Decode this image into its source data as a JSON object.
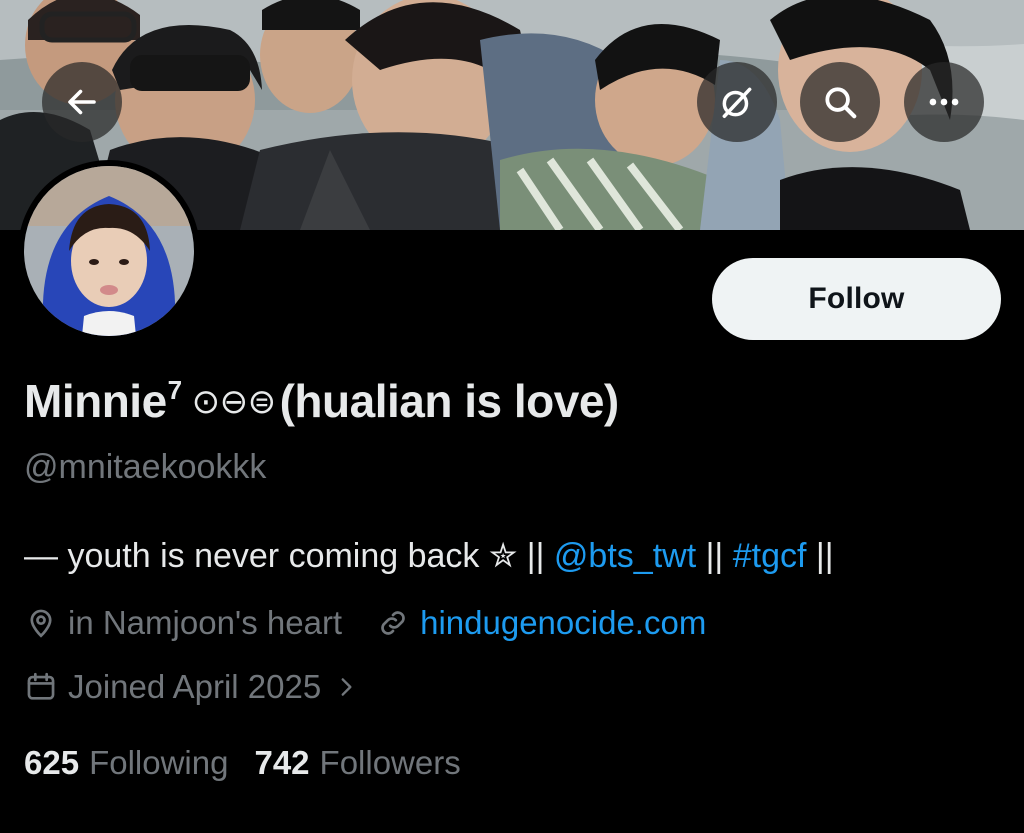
{
  "header": {
    "back_icon": "arrow-left-icon",
    "grok_icon": "grok-icon",
    "search_icon": "search-icon",
    "more_icon": "more-horizontal-icon"
  },
  "profile": {
    "follow_label": "Follow",
    "name_main": "Minnie",
    "name_sup": "7",
    "name_symbols": "⊙⊖⊜",
    "name_rest": "(hualian is love)",
    "handle": "@mnitaekookkk",
    "bio": {
      "text1": "— youth is never coming back ✮ || ",
      "mention": "@bts_twt",
      "text2": " || ",
      "hashtag": "#tgcf",
      "text3": " ||"
    },
    "location": "in Namjoon's heart",
    "website": "hindugenocide.com",
    "joined": "Joined April 2025",
    "following_count": "625",
    "following_label": "Following",
    "followers_count": "742",
    "followers_label": "Followers"
  },
  "colors": {
    "background": "#000000",
    "text_primary": "#e7e9ea",
    "text_secondary": "#71767b",
    "link": "#1d9bf0",
    "follow_bg": "#eff3f4"
  }
}
